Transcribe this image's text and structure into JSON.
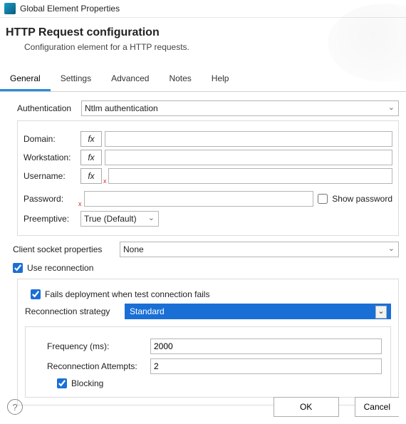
{
  "window": {
    "title": "Global Element Properties"
  },
  "header": {
    "title": "HTTP Request configuration",
    "subtitle": "Configuration element for a HTTP requests."
  },
  "tabs": [
    "General",
    "Settings",
    "Advanced",
    "Notes",
    "Help"
  ],
  "general": {
    "auth_label": "Authentication",
    "auth_value": "Ntlm authentication",
    "domain_label": "Domain:",
    "workstation_label": "Workstation:",
    "username_label": "Username:",
    "password_label": "Password:",
    "show_password_label": "Show password",
    "preemptive_label": "Preemptive:",
    "preemptive_value": "True (Default)",
    "domain_value": "",
    "workstation_value": "",
    "username_value": "",
    "password_value": ""
  },
  "client_socket": {
    "label": "Client socket properties",
    "value": "None"
  },
  "reconnection": {
    "use_label": "Use reconnection",
    "use_checked": true,
    "fails_label": "Fails deployment when test connection fails",
    "fails_checked": true,
    "strategy_label": "Reconnection strategy",
    "strategy_value": "Standard",
    "frequency_label": "Frequency (ms):",
    "frequency_value": "2000",
    "attempts_label": "Reconnection Attempts:",
    "attempts_value": "2",
    "blocking_label": "Blocking",
    "blocking_checked": true
  },
  "fx_label": "fx",
  "footer": {
    "ok": "OK",
    "cancel": "Cancel"
  }
}
